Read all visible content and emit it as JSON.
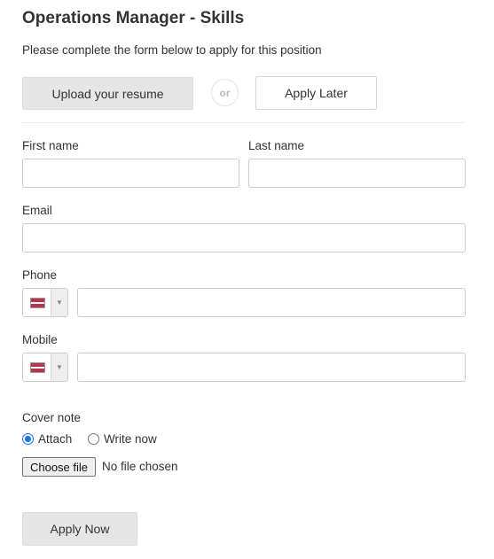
{
  "header": {
    "title": "Operations Manager - Skills",
    "subtitle": "Please complete the form below to apply for this position"
  },
  "actions": {
    "upload_label": "Upload your resume",
    "or_label": "or",
    "apply_later_label": "Apply Later"
  },
  "form": {
    "first_name": {
      "label": "First name",
      "value": ""
    },
    "last_name": {
      "label": "Last name",
      "value": ""
    },
    "email": {
      "label": "Email",
      "value": ""
    },
    "phone": {
      "label": "Phone",
      "value": "",
      "country_flag": "flag-icon"
    },
    "mobile": {
      "label": "Mobile",
      "value": "",
      "country_flag": "flag-icon"
    },
    "cover_note": {
      "label": "Cover note",
      "options": [
        {
          "label": "Attach",
          "checked": true
        },
        {
          "label": "Write now",
          "checked": false
        }
      ],
      "choose_file_label": "Choose file",
      "file_status": "No file chosen"
    }
  },
  "submit": {
    "label": "Apply Now"
  },
  "colors": {
    "button_gray": "#e6e6e6",
    "radio_accent": "#1a73e8",
    "flag_red": "#b5344d",
    "border": "#cccccc"
  }
}
